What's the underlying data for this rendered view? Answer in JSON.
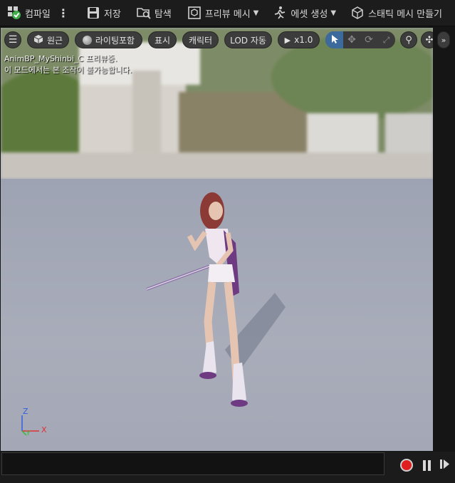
{
  "toolbar": {
    "compile_label": "컴파일",
    "save_label": "저장",
    "browse_label": "탐색",
    "preview_mesh_label": "프리뷰 메시",
    "asset_create_label": "에셋 생성",
    "static_mesh_label": "스태틱 메시 만들기"
  },
  "viewport": {
    "perspective_label": "원근",
    "lighting_label": "라이팅포함",
    "show_label": "표시",
    "character_label": "캐릭터",
    "lod_label": "LOD 자동",
    "play_speed_label": "x1.0",
    "info_line1": "AnimBP_MyShinbi_C 프리뷰중.",
    "info_line2": "이 모드에서는 본 조작이 불가능합니다.",
    "axis_z": "Z",
    "axis_y": "Y",
    "axis_x": "X"
  },
  "colors": {
    "toolbar_bg": "#1c1c1c",
    "accent_blue": "#3c6a9c",
    "compile_ok": "#3fae49",
    "record_red": "#e02020",
    "axis_x": "#e03030",
    "axis_y": "#30c030",
    "axis_z": "#3060e0"
  }
}
